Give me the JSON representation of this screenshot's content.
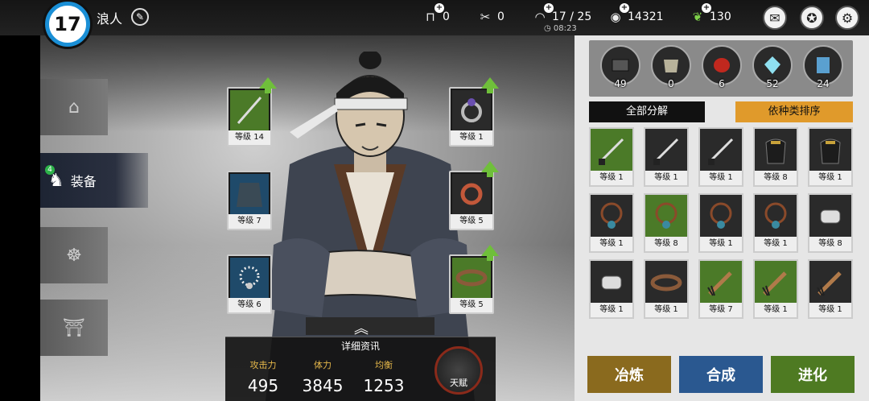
{
  "player": {
    "level": "17",
    "name": "浪人"
  },
  "resources": [
    {
      "icon": "bed-icon",
      "value": "0"
    },
    {
      "icon": "bandage-icon",
      "value": "0"
    },
    {
      "icon": "helmet-icon",
      "value": "17 / 25"
    },
    {
      "icon": "coin-icon",
      "value": "14321"
    },
    {
      "icon": "jade-icon",
      "value": "130"
    }
  ],
  "timer": "08:23",
  "nav": {
    "active_label": "装备",
    "active_badge": "4"
  },
  "equipped": {
    "sword": "等级 14",
    "ring": "等级 1",
    "robe": "等级 7",
    "charm": "等级 5",
    "necklace": "等级 6",
    "belt": "等级 5"
  },
  "details": {
    "title": "详细资讯",
    "stats": [
      {
        "key": "攻击力",
        "value": "495"
      },
      {
        "key": "体力",
        "value": "3845"
      },
      {
        "key": "均衡",
        "value": "1253"
      }
    ],
    "talent_label": "天赋"
  },
  "materials": [
    {
      "icon": "ink-stone-icon",
      "count": "49"
    },
    {
      "icon": "cloth-icon",
      "count": "0"
    },
    {
      "icon": "red-gem-icon",
      "count": "6"
    },
    {
      "icon": "blue-crystal-icon",
      "count": "52"
    },
    {
      "icon": "scroll-icon",
      "count": "24"
    }
  ],
  "buttons": {
    "dismantle_all": "全部分解",
    "sort_by_type": "依种类排序",
    "refine": "冶炼",
    "combine": "合成",
    "evolve": "进化"
  },
  "inventory": [
    {
      "icon": "katana-icon",
      "level": "等级 1",
      "green": true
    },
    {
      "icon": "katana-icon",
      "level": "等级 1",
      "green": false
    },
    {
      "icon": "katana-icon",
      "level": "等级 1",
      "green": false
    },
    {
      "icon": "armor-icon",
      "level": "等级 8",
      "green": false
    },
    {
      "icon": "armor-icon",
      "level": "等级 1",
      "green": false
    },
    {
      "icon": "necklace-icon",
      "level": "等级 1",
      "green": false
    },
    {
      "icon": "necklace-icon",
      "level": "等级 8",
      "green": true
    },
    {
      "icon": "necklace-icon",
      "level": "等级 1",
      "green": false
    },
    {
      "icon": "necklace-icon",
      "level": "等级 1",
      "green": false
    },
    {
      "icon": "bracer-icon",
      "level": "等级 8",
      "green": false
    },
    {
      "icon": "bracer-icon",
      "level": "等级 1",
      "green": false
    },
    {
      "icon": "belt-icon",
      "level": "等级 1",
      "green": false
    },
    {
      "icon": "tassel-icon",
      "level": "等级 7",
      "green": true
    },
    {
      "icon": "tassel-icon",
      "level": "等级 1",
      "green": true
    },
    {
      "icon": "tassel-icon",
      "level": "等级 1",
      "green": false
    }
  ]
}
